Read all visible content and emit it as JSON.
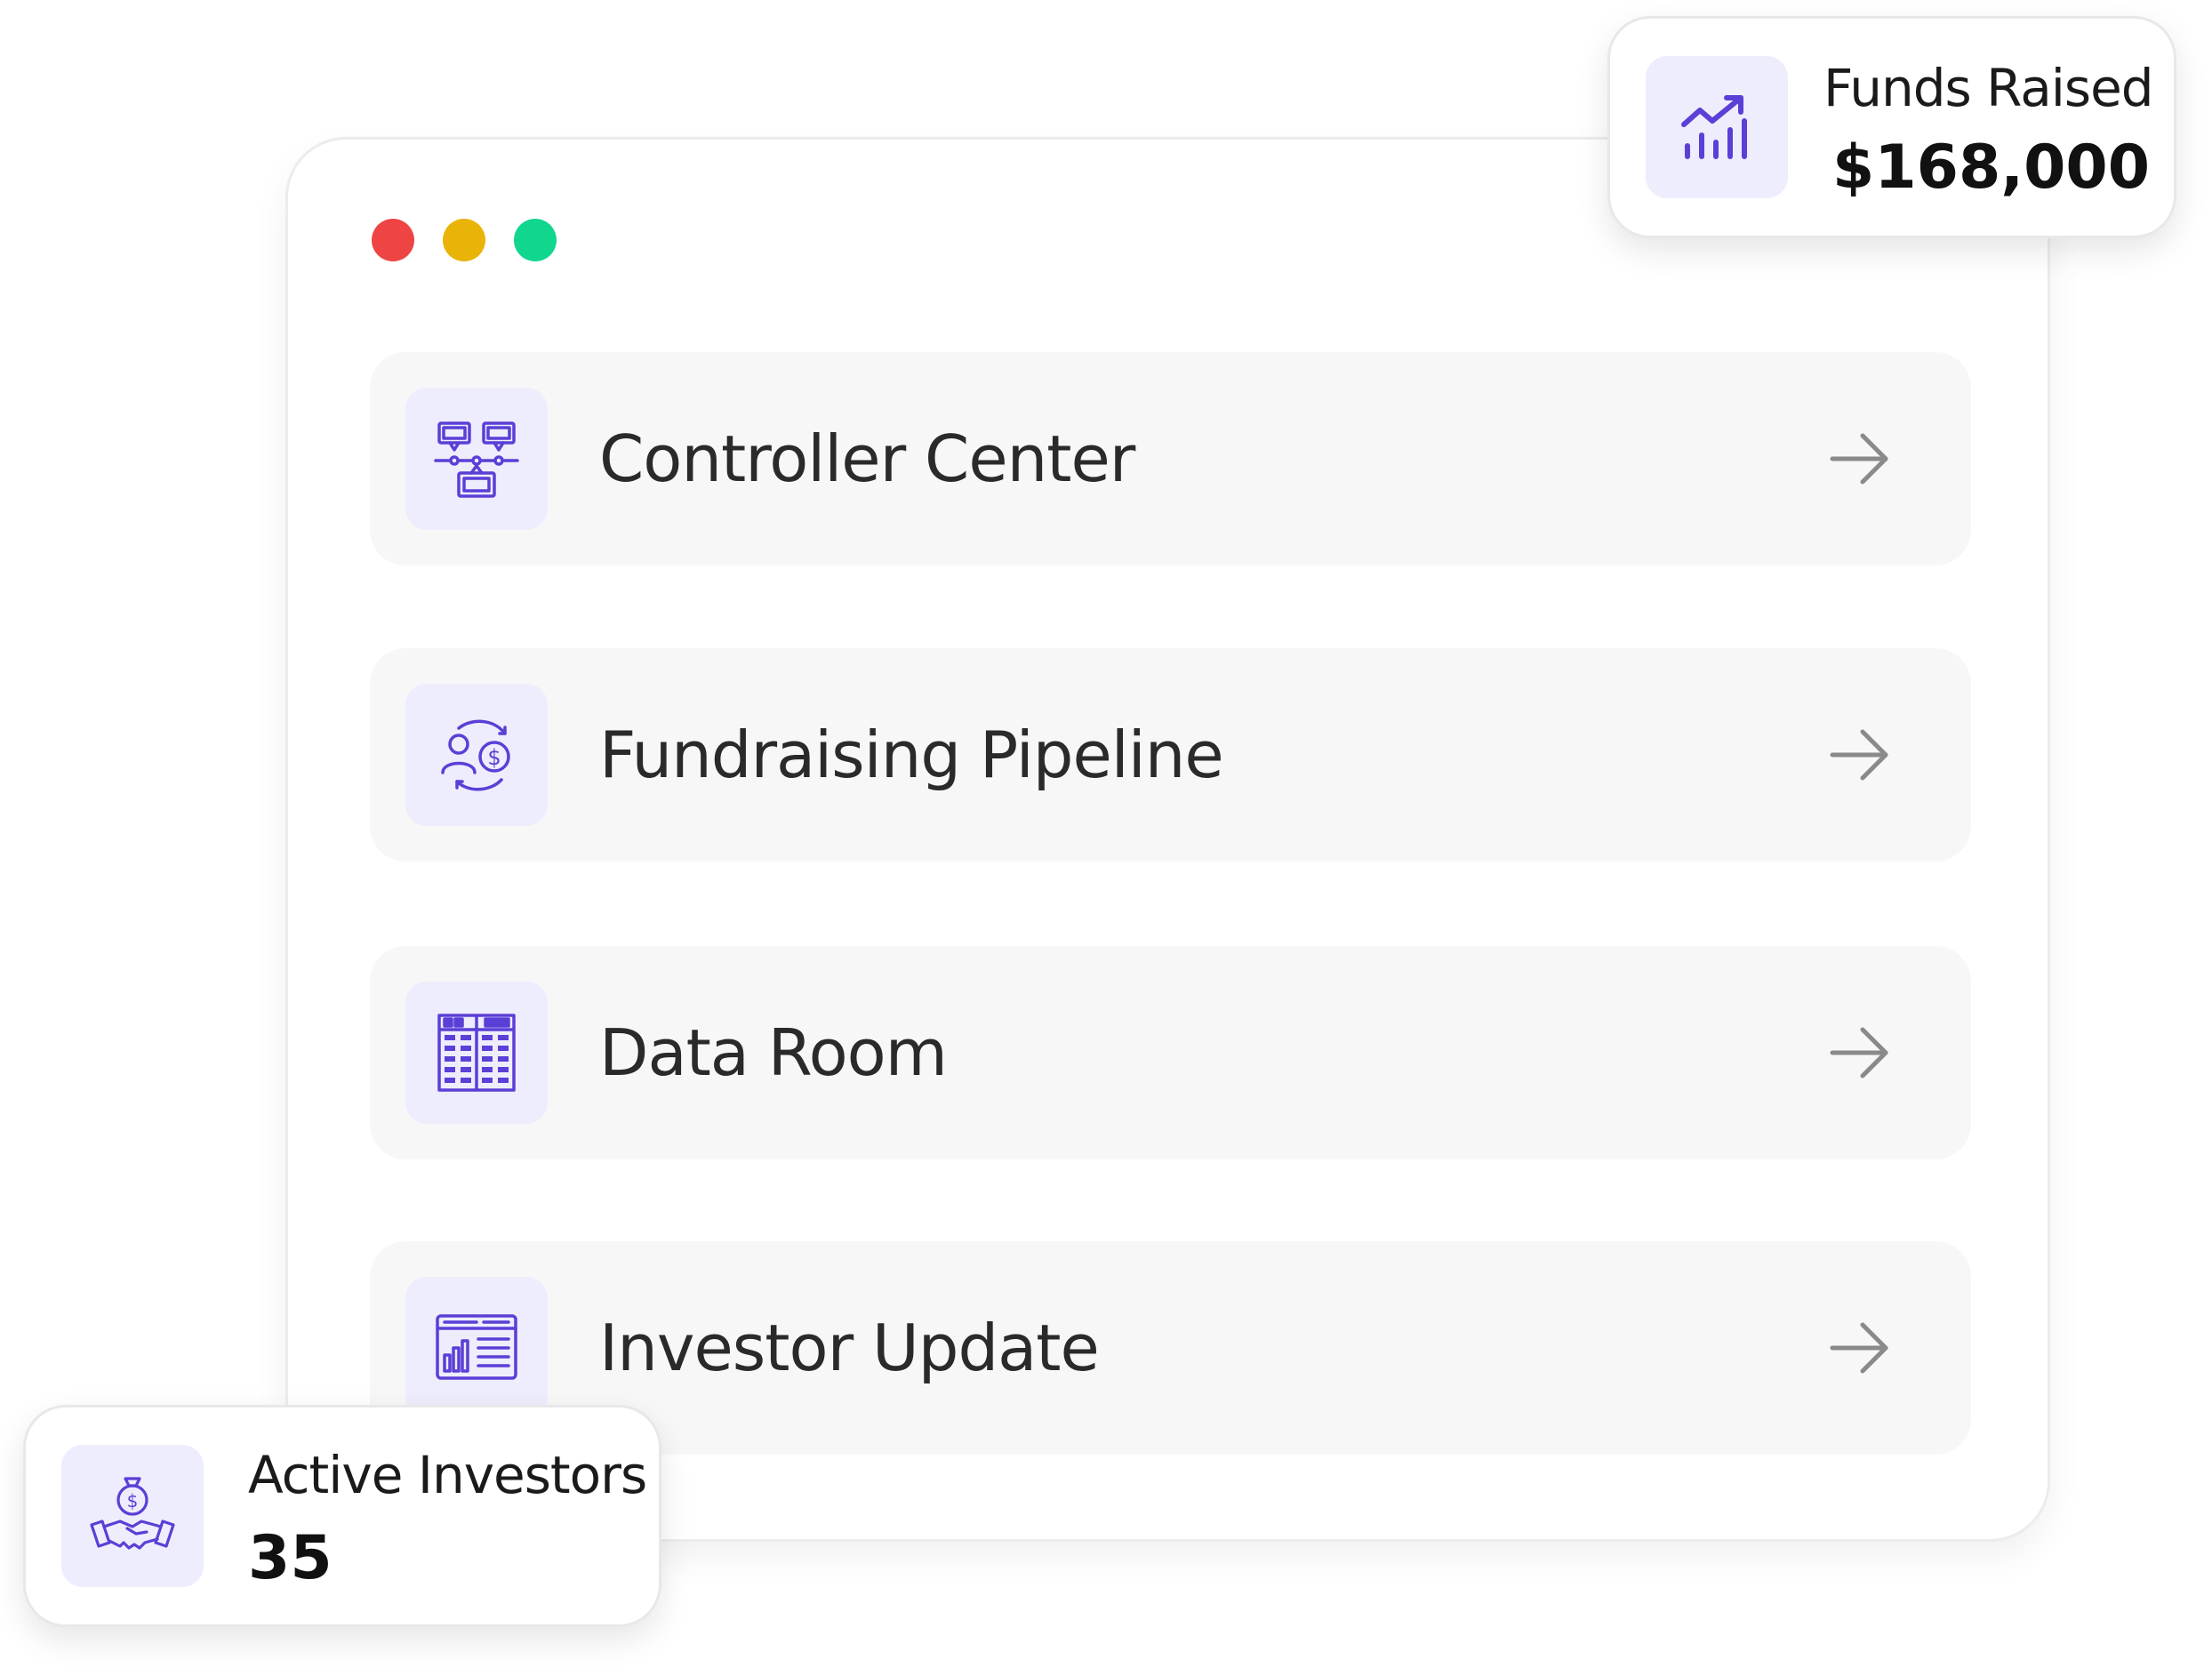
{
  "window": {
    "traffic_lights": [
      {
        "name": "close",
        "color": "#ef4444"
      },
      {
        "name": "minimize",
        "color": "#eab308"
      },
      {
        "name": "maximize",
        "color": "#10d68e"
      }
    ]
  },
  "menu": {
    "items": [
      {
        "label": "Controller Center",
        "icon": "org-chart-icon"
      },
      {
        "label": "Fundraising Pipeline",
        "icon": "investor-cycle-icon"
      },
      {
        "label": "Data Room",
        "icon": "building-grid-icon"
      },
      {
        "label": "Investor Update",
        "icon": "report-chart-icon"
      }
    ],
    "arrow_icon": "arrow-right-icon"
  },
  "funds_card": {
    "label": "Funds Raised",
    "value": "$168,000",
    "icon": "trending-bars-icon"
  },
  "investors_card": {
    "label": "Active Investors",
    "value": "35",
    "icon": "handshake-moneybag-icon"
  },
  "colors": {
    "accent": "#5b3fd6",
    "icon_bg": "#eeedfd",
    "row_bg": "#f7f7f7",
    "arrow": "#888888"
  }
}
